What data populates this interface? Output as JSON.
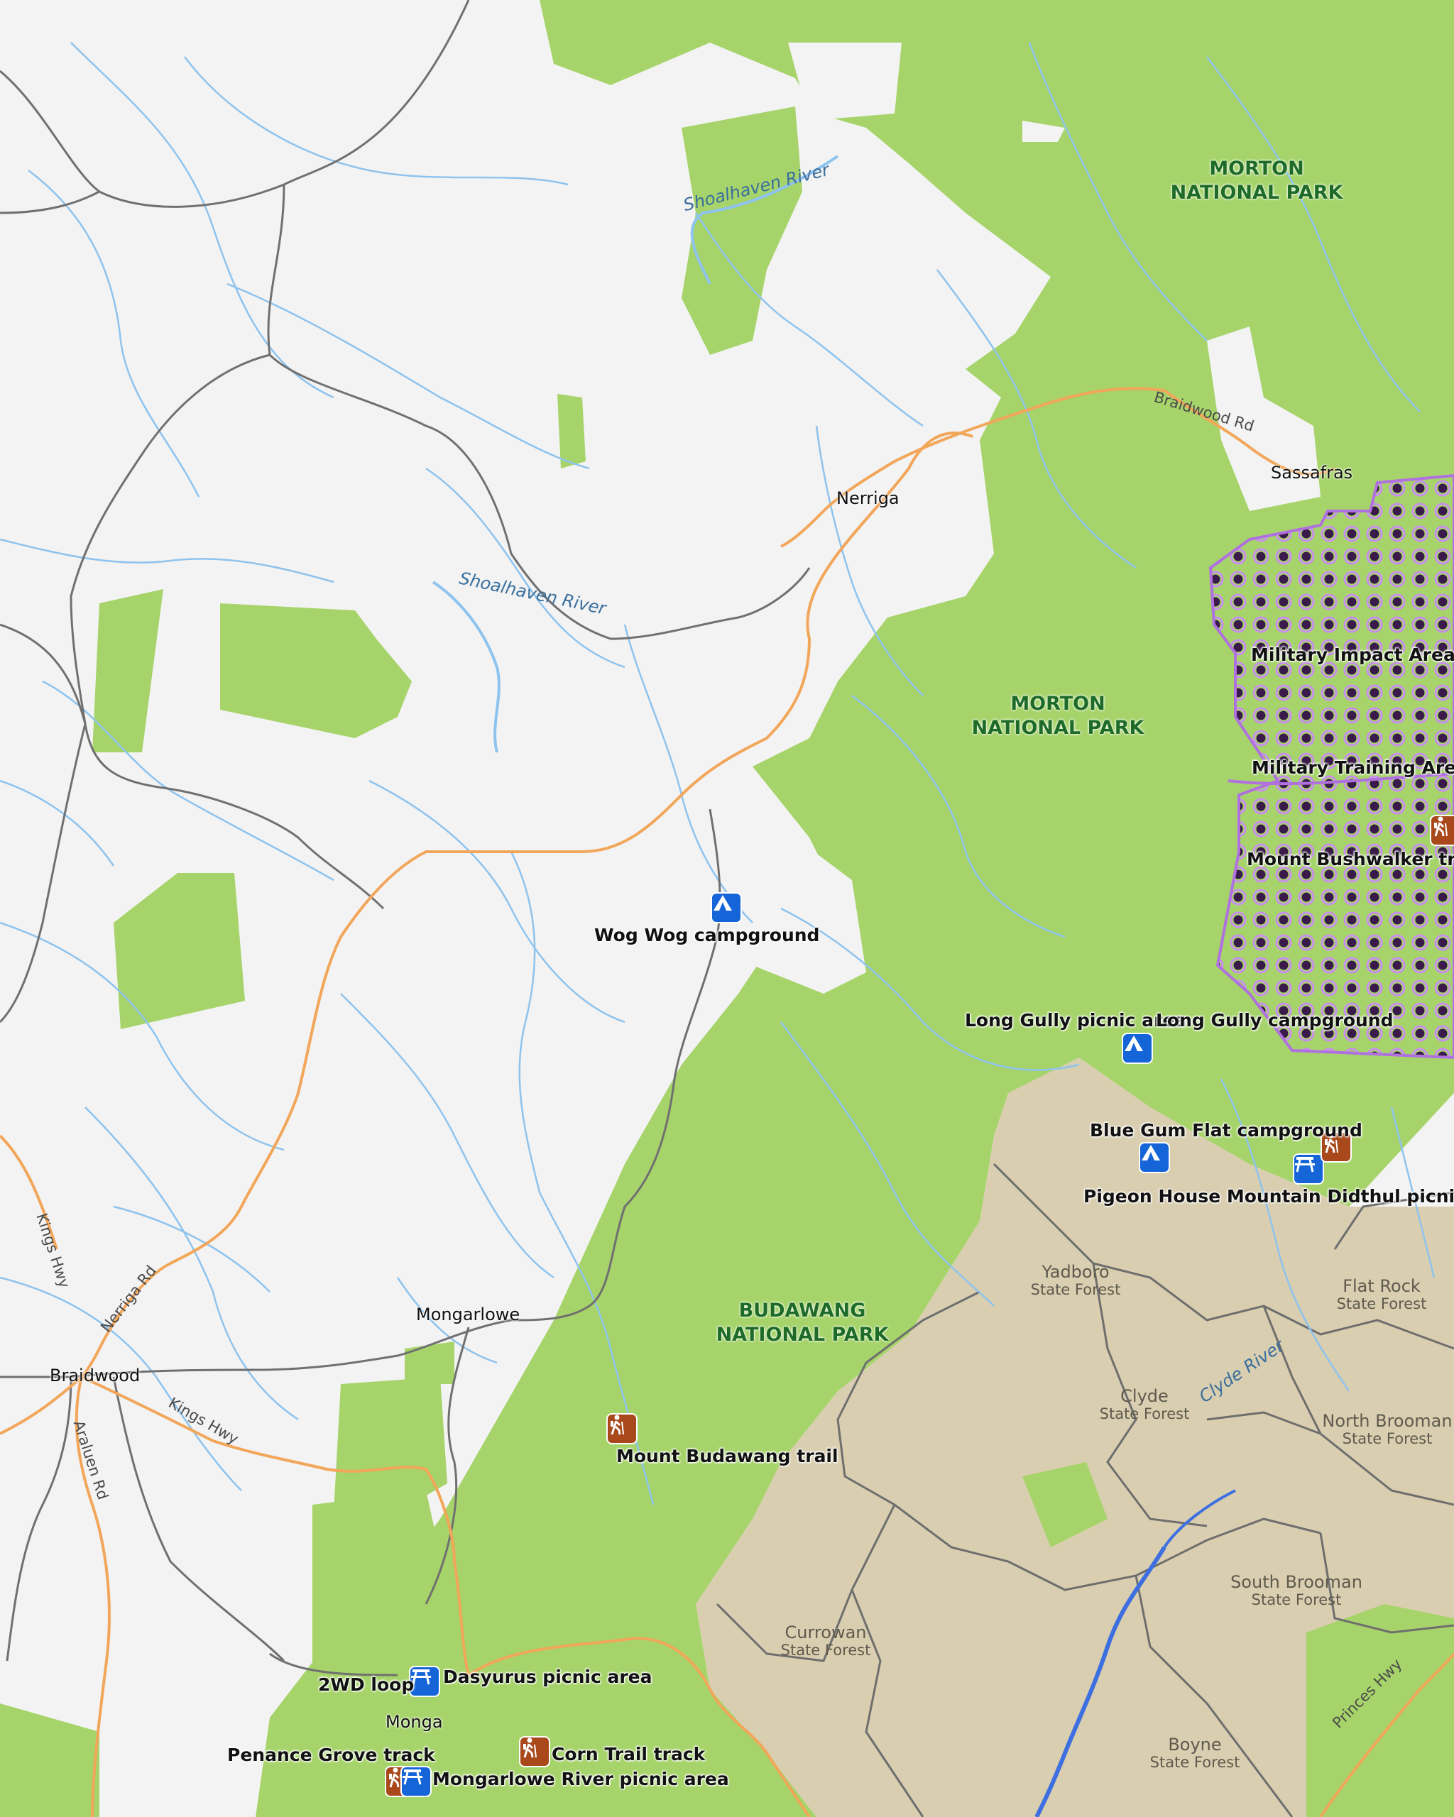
{
  "map": {
    "parks": [
      {
        "line1": "MORTON",
        "line2": "NATIONAL PARK"
      },
      {
        "line1": "MORTON",
        "line2": "NATIONAL PARK"
      },
      {
        "line1": "BUDAWANG",
        "line2": "NATIONAL PARK"
      }
    ],
    "military": [
      "Military Impact Area",
      "Military Training Area"
    ],
    "towns": [
      "Nerriga",
      "Sassafras",
      "Mongarlowe",
      "Braidwood",
      "Monga"
    ],
    "rivers": [
      "Shoalhaven River",
      "Shoalhaven River",
      "Clyde River"
    ],
    "roads": [
      "Braidwood Rd",
      "Nerriga Rd",
      "Kings Hwy",
      "Kings Hwy",
      "Araluen Rd",
      "Princes Hwy"
    ],
    "forests": [
      {
        "name": "Yadboro",
        "sub": "State Forest"
      },
      {
        "name": "Flat Rock",
        "sub": "State Forest"
      },
      {
        "name": "Clyde",
        "sub": "State Forest"
      },
      {
        "name": "North Brooman",
        "sub": "State Forest"
      },
      {
        "name": "Currowan",
        "sub": "State Forest"
      },
      {
        "name": "South Brooman",
        "sub": "State Forest"
      },
      {
        "name": "Boyne",
        "sub": "State Forest"
      }
    ],
    "pois": [
      {
        "label": "Wog Wog campground",
        "icon": "tent-icon"
      },
      {
        "label": "Long Gully picnic area",
        "icon": "none"
      },
      {
        "label": "Long Gully campground",
        "icon": "tent-icon"
      },
      {
        "label": "Blue Gum Flat campground",
        "icon": "tent-icon"
      },
      {
        "label": "Pigeon House Mountain Didthul picnic area",
        "icon": "picnic-table-icon"
      },
      {
        "label": "Mount Bushwalker track",
        "icon": "hiker-icon"
      },
      {
        "label": "Mount Budawang trail",
        "icon": "hiker-icon"
      },
      {
        "label": "2WD loop",
        "icon": "none"
      },
      {
        "label": "Dasyurus picnic area",
        "icon": "picnic-table-icon"
      },
      {
        "label": "Penance Grove track",
        "icon": "hiker-icon"
      },
      {
        "label": "Corn Trail track",
        "icon": "hiker-icon"
      },
      {
        "label": "Mongarlowe River picnic area",
        "icon": "picnic-table-icon"
      }
    ],
    "colors": {
      "background": "#f3f3f3",
      "park": "#a6d46a",
      "state_forest": "#d9ceb0",
      "river": "#8ec3ee",
      "major_road": "#f2a65a",
      "minor_road": "#707070",
      "military": "#b070e0",
      "campground_icon": "#1565d8",
      "walking_icon": "#a8481b"
    }
  }
}
